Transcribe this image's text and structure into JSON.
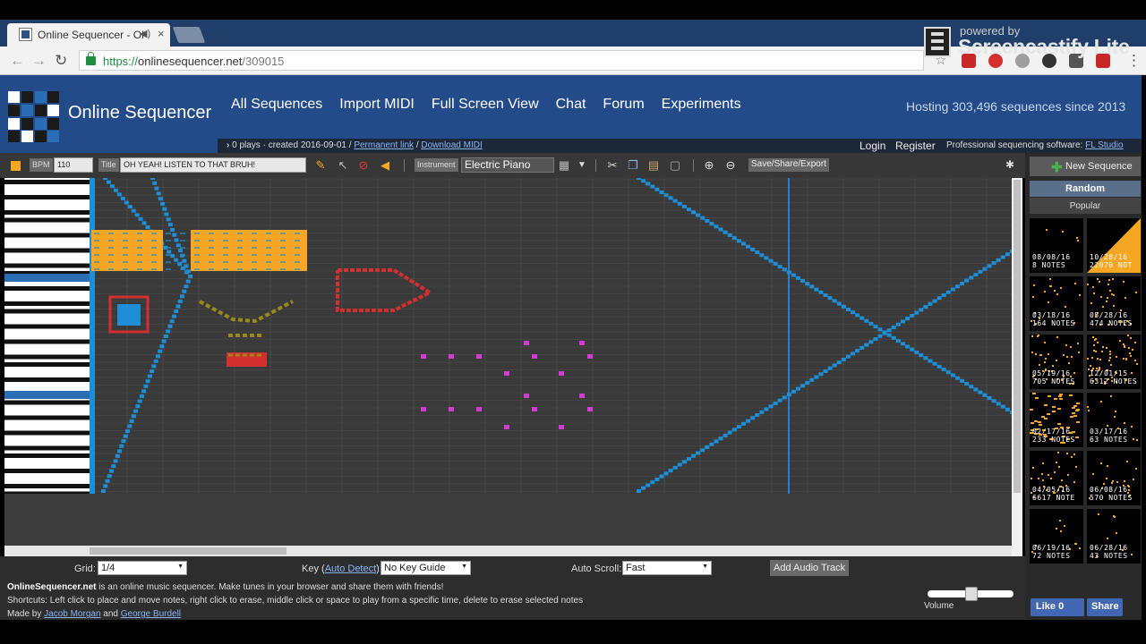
{
  "browser": {
    "tab_title": "Online Sequencer - Ol",
    "url_secure": "https://",
    "url_host": "onlinesequencer.net",
    "url_path": "/309015",
    "screencast_powered": "powered by",
    "screencast_name": "Screencastify Lite"
  },
  "site": {
    "logo_text": "Online Sequencer",
    "nav": [
      "All Sequences",
      "Import MIDI",
      "Full Screen View",
      "Chat",
      "Forum",
      "Experiments"
    ],
    "hosting": "Hosting 303,496 sequences since 2013",
    "plays_info": "0 plays · created 2016-09-01 /",
    "permanent_link": "Permanent link",
    "separator": "/",
    "download_midi": "Download MIDI",
    "login": "Login",
    "register": "Register",
    "pro_text": "Professional sequencing software:",
    "pro_link": "FL Studio"
  },
  "editor_toolbar": {
    "bpm_label": "BPM",
    "bpm_value": "110",
    "title_label": "Title",
    "title_value": "OH YEAH! LISTEN TO THAT BRUH!",
    "instrument_label": "Instrument",
    "instrument_value": "Electric Piano",
    "save_label": "Save/Share/Export"
  },
  "bottom": {
    "grid_label": "Grid:",
    "grid_value": "1/4",
    "key_label_prefix": "Key (",
    "key_link": "Auto Detect",
    "key_label_suffix": "):",
    "key_value": "No Key Guide",
    "autoscroll_label": "Auto Scroll:",
    "autoscroll_value": "Fast",
    "add_audio": "Add Audio Track",
    "desc_site": "OnlineSequencer.net",
    "desc_text": " is an online music sequencer. Make tunes in your browser and share them with friends!",
    "shortcuts": "Shortcuts: Left click to place and move notes, right click to erase, middle click or space to play from a specific time, delete to erase selected notes",
    "made_by": "Made by ",
    "author1": "Jacob Morgan",
    "and": " and ",
    "author2": "George Burdell",
    "volume_label": "Volume",
    "volume_level": 0.5
  },
  "sidebar": {
    "new_sequence": "New Sequence",
    "tab_random": "Random",
    "tab_popular": "Popular",
    "thumbnails": [
      {
        "date": "08/08/16",
        "notes": "8 NOTES"
      },
      {
        "date": "10/28/16",
        "notes": "22070 NOT"
      },
      {
        "date": "03/18/16",
        "notes": "164 NOTES"
      },
      {
        "date": "05/28/16",
        "notes": "474 NOTES"
      },
      {
        "date": "05/19/16",
        "notes": "705 NOTES"
      },
      {
        "date": "12/01/15",
        "notes": "6312 NOTES"
      },
      {
        "date": "02/17/16",
        "notes": "233 NOTES"
      },
      {
        "date": "03/17/16",
        "notes": "63 NOTES"
      },
      {
        "date": "04/05/16",
        "notes": "6617 NOTE"
      },
      {
        "date": "06/08/16",
        "notes": "570 NOTES"
      },
      {
        "date": "06/19/16",
        "notes": "72 NOTES"
      },
      {
        "date": "06/28/16",
        "notes": "43 NOTES"
      }
    ],
    "fb_like": "Like 0",
    "fb_share": "Share"
  },
  "colors": {
    "header_blue": "#234b8a",
    "note_blue": "#1e8fd6",
    "note_orange": "#f5a623",
    "note_red": "#d32f2f",
    "note_olive": "#9a8a1a",
    "note_magenta": "#d23cd2"
  }
}
